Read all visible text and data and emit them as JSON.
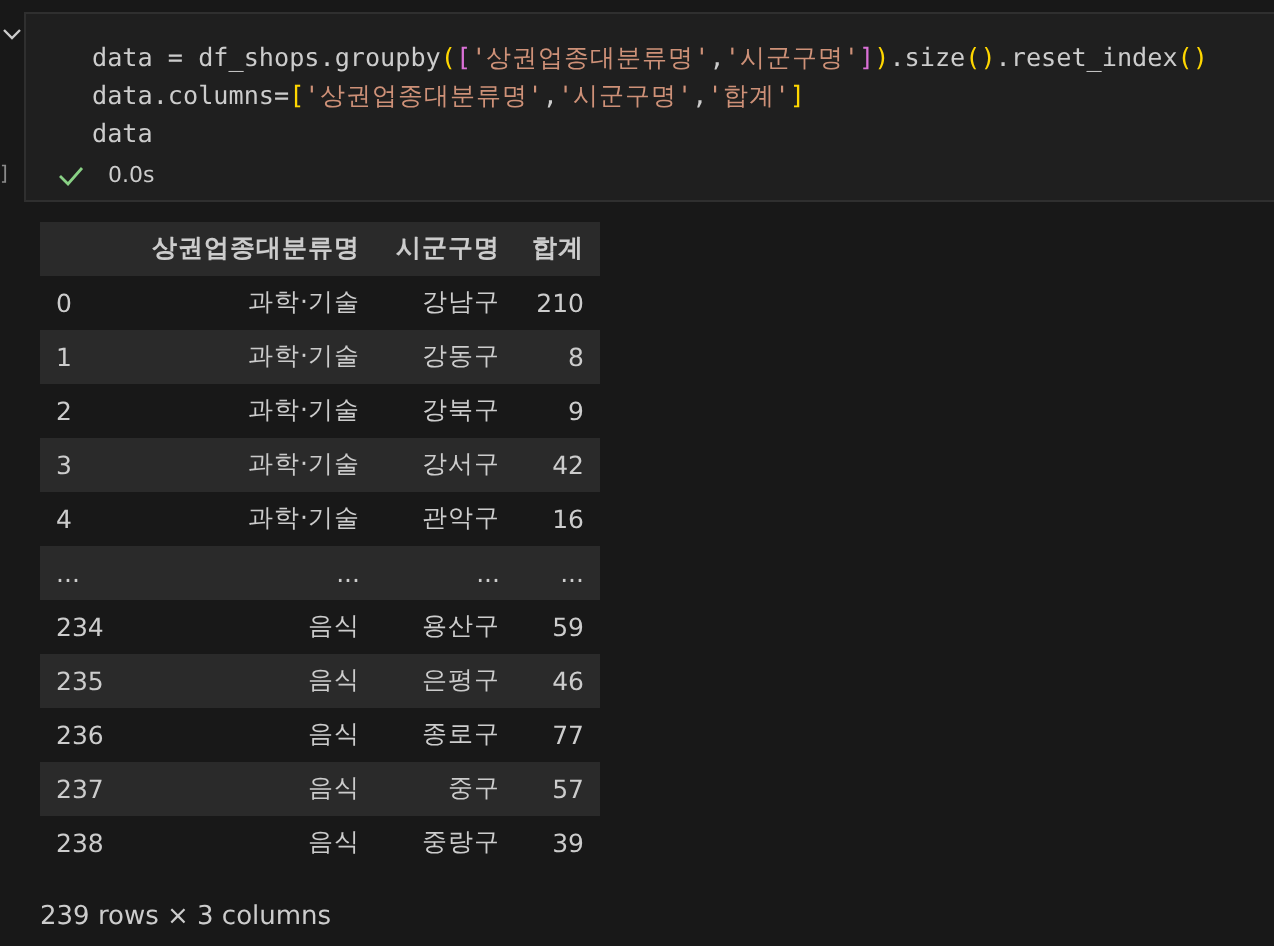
{
  "cell": {
    "execution_marker": "]",
    "code_lines": [
      [
        {
          "kind": "plain",
          "text": "data = df_shops.groupby"
        },
        {
          "kind": "bracket-1",
          "text": "("
        },
        {
          "kind": "bracket-2",
          "text": "["
        },
        {
          "kind": "string",
          "text": "'상권업종대분류명'"
        },
        {
          "kind": "plain",
          "text": ","
        },
        {
          "kind": "string",
          "text": "'시군구명'"
        },
        {
          "kind": "bracket-2",
          "text": "]"
        },
        {
          "kind": "bracket-1",
          "text": ")"
        },
        {
          "kind": "plain",
          "text": ".size"
        },
        {
          "kind": "bracket-1",
          "text": "()"
        },
        {
          "kind": "plain",
          "text": ".reset_index"
        },
        {
          "kind": "bracket-1",
          "text": "()"
        }
      ],
      [
        {
          "kind": "plain",
          "text": "data.columns="
        },
        {
          "kind": "bracket-1",
          "text": "["
        },
        {
          "kind": "string",
          "text": "'상권업종대분류명'"
        },
        {
          "kind": "plain",
          "text": ","
        },
        {
          "kind": "string",
          "text": "'시군구명'"
        },
        {
          "kind": "plain",
          "text": ","
        },
        {
          "kind": "string",
          "text": "'합계'"
        },
        {
          "kind": "bracket-1",
          "text": "]"
        }
      ],
      [
        {
          "kind": "plain",
          "text": "data"
        }
      ]
    ],
    "succeeded": true,
    "duration": "0.0s"
  },
  "table": {
    "columns": [
      "",
      "상권업종대분류명",
      "시군구명",
      "합계"
    ],
    "rows": [
      [
        "0",
        "과학·기술",
        "강남구",
        "210"
      ],
      [
        "1",
        "과학·기술",
        "강동구",
        "8"
      ],
      [
        "2",
        "과학·기술",
        "강북구",
        "9"
      ],
      [
        "3",
        "과학·기술",
        "강서구",
        "42"
      ],
      [
        "4",
        "과학·기술",
        "관악구",
        "16"
      ],
      [
        "...",
        "...",
        "...",
        "..."
      ],
      [
        "234",
        "음식",
        "용산구",
        "59"
      ],
      [
        "235",
        "음식",
        "은평구",
        "46"
      ],
      [
        "236",
        "음식",
        "종로구",
        "77"
      ],
      [
        "237",
        "음식",
        "중구",
        "57"
      ],
      [
        "238",
        "음식",
        "중랑구",
        "39"
      ]
    ]
  },
  "footer": "239 rows × 3 columns"
}
